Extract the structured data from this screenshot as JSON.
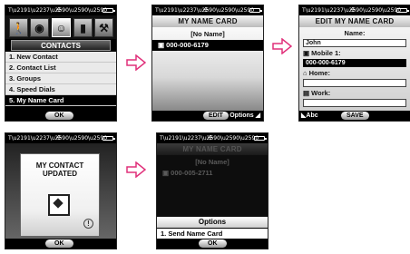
{
  "screen1": {
    "status_mid": "✣",
    "menu_icons": [
      "person-walk-icon",
      "camera-icon",
      "contacts-icon",
      "speaker-icon",
      "settings-tools-icon"
    ],
    "header": "CONTACTS",
    "items": [
      "1. New Contact",
      "2. Contact List",
      "3. Groups",
      "4. Speed Dials",
      "5. My Name Card"
    ],
    "ok": "OK"
  },
  "screen2": {
    "title": "MY NAME CARD",
    "name": "[No Name]",
    "number": "000-000-6179",
    "edit": "EDIT",
    "options": "Options"
  },
  "screen3": {
    "title": "EDIT MY NAME CARD",
    "name_label": "Name:",
    "name_value": "John",
    "mobile_label": "Mobile 1:",
    "mobile_value": "000-000-6179",
    "home_label": "Home:",
    "home_value": "",
    "work_label": "Work:",
    "work_value": "",
    "input_mode": "Abc",
    "save": "SAVE"
  },
  "screen4": {
    "message_line1": "MY CONTACT",
    "message_line2": "UPDATED",
    "ok": "OK"
  },
  "screen5": {
    "title": "MY NAME CARD",
    "name": "[No Name]",
    "number": "000-005-2711",
    "options_title": "Options",
    "option1": "1. Send Name Card",
    "ok": "OK"
  }
}
